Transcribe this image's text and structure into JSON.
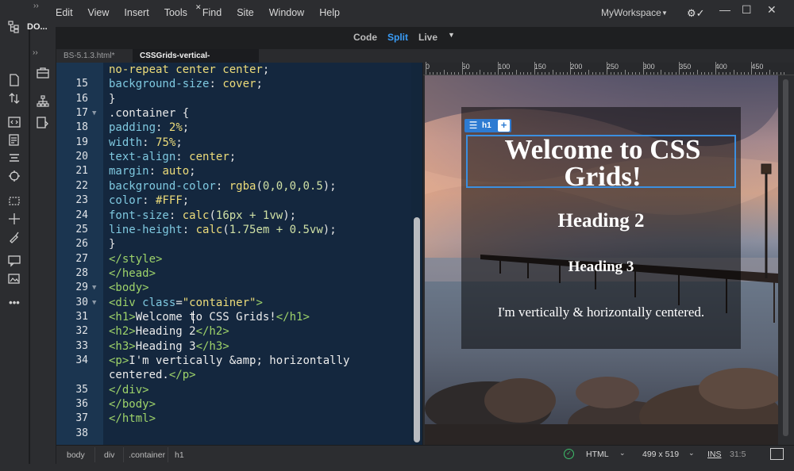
{
  "menu": [
    "Edit",
    "View",
    "Insert",
    "Tools",
    "Find",
    "Site",
    "Window",
    "Help"
  ],
  "workspace": "MyWorkspace",
  "dom_panel_label": "DO...",
  "view_switcher": {
    "code": "Code",
    "split": "Split",
    "live": "Live"
  },
  "tabs": [
    {
      "label": "BS-5.1.3.html*",
      "active": false
    },
    {
      "label": "CSSGrids-vertical-center.html",
      "active": true
    }
  ],
  "code_lines": [
    {
      "ln": "",
      "fold": false,
      "html": "[[v]]no-repeat center center[[/]][[p]];[[/]]"
    },
    {
      "ln": "15",
      "fold": false,
      "html": "[[a]]background-size[[/]][[p]]:[[/]] [[v]]cover[[/]][[p]];[[/]]"
    },
    {
      "ln": "16",
      "fold": false,
      "html": "[[p]]}[[/]]"
    },
    {
      "ln": "17",
      "fold": true,
      "html": "[[s]].container {[[/]]"
    },
    {
      "ln": "18",
      "fold": false,
      "html": "[[a]]padding[[/]][[p]]:[[/]] [[v]]2%[[/]][[p]];[[/]]"
    },
    {
      "ln": "19",
      "fold": false,
      "html": "[[a]]width[[/]][[p]]:[[/]] [[v]]75%[[/]][[p]];[[/]]"
    },
    {
      "ln": "20",
      "fold": false,
      "html": "[[a]]text-align[[/]][[p]]:[[/]] [[v]]center[[/]][[p]];[[/]]"
    },
    {
      "ln": "21",
      "fold": false,
      "html": "[[a]]margin[[/]][[p]]:[[/]] [[v]]auto[[/]][[p]];[[/]]"
    },
    {
      "ln": "22",
      "fold": false,
      "html": "[[a]]background-color[[/]][[p]]:[[/]] [[v]]rgba[[/]][[p]]([[/]][[n]]0,0,0,0.5[[/]][[p]]);[[/]]"
    },
    {
      "ln": "23",
      "fold": false,
      "html": "[[a]]color[[/]][[p]]:[[/]] [[v]]#FFF[[/]][[p]];[[/]]"
    },
    {
      "ln": "24",
      "fold": false,
      "html": "[[a]]font-size[[/]][[p]]:[[/]] [[v]]calc[[/]][[p]]([[/]][[n]]16px + 1vw[[/]][[p]]);[[/]]"
    },
    {
      "ln": "25",
      "fold": false,
      "html": "[[a]]line-height[[/]][[p]]:[[/]] [[v]]calc[[/]][[p]]([[/]][[n]]1.75em + 0.5vw[[/]][[p]]);[[/]]"
    },
    {
      "ln": "26",
      "fold": false,
      "html": "[[p]]}[[/]]"
    },
    {
      "ln": "27",
      "fold": false,
      "html": "[[g]]</style>[[/]]"
    },
    {
      "ln": "28",
      "fold": false,
      "html": "[[g]]</head>[[/]]"
    },
    {
      "ln": "29",
      "fold": true,
      "html": "[[g]]<body>[[/]]"
    },
    {
      "ln": "30",
      "fold": true,
      "html": "[[g]]<div[[/]] [[a]]class[[/]][[p]]=[[/]][[v]]\"container\"[[/]][[g]]>[[/]]"
    },
    {
      "ln": "31",
      "fold": false,
      "html": "[[g]]<h1>[[/]][[t]]Welcome to CSS Grids![[/]][[g]]</h1>[[/]]"
    },
    {
      "ln": "32",
      "fold": false,
      "html": "[[g]]<h2>[[/]][[t]]Heading 2[[/]][[g]]</h2>[[/]]"
    },
    {
      "ln": "33",
      "fold": false,
      "html": "[[g]]<h3>[[/]][[t]]Heading 3[[/]][[g]]</h3>[[/]]"
    },
    {
      "ln": "34",
      "fold": false,
      "html": "[[g]]<p>[[/]][[t]]I'm vertically &amp; horizontally[[/]]"
    },
    {
      "ln": "",
      "fold": false,
      "html": "[[t]]centered.[[/]][[g]]</p>[[/]]"
    },
    {
      "ln": "35",
      "fold": false,
      "html": "[[g]]</div>[[/]]"
    },
    {
      "ln": "36",
      "fold": false,
      "html": "[[g]]</body>[[/]]"
    },
    {
      "ln": "37",
      "fold": false,
      "html": "[[g]]</html>[[/]]"
    },
    {
      "ln": "38",
      "fold": false,
      "html": ""
    }
  ],
  "ruler_labels": [
    "0",
    "50",
    "100",
    "150",
    "200",
    "250",
    "300",
    "350",
    "400",
    "450"
  ],
  "live": {
    "hud_tag": "h1",
    "hud_plus": "+",
    "h1": "Welcome to CSS Grids!",
    "h2": "Heading 2",
    "h3": "Heading 3",
    "p": "I'm vertically & horizontally centered."
  },
  "breadcrumbs": [
    "body",
    "div",
    ".container",
    "h1"
  ],
  "status": {
    "doc_type": "HTML",
    "window_size": "499 x 519",
    "mode": "INS",
    "cursor_pos": "31:5"
  }
}
